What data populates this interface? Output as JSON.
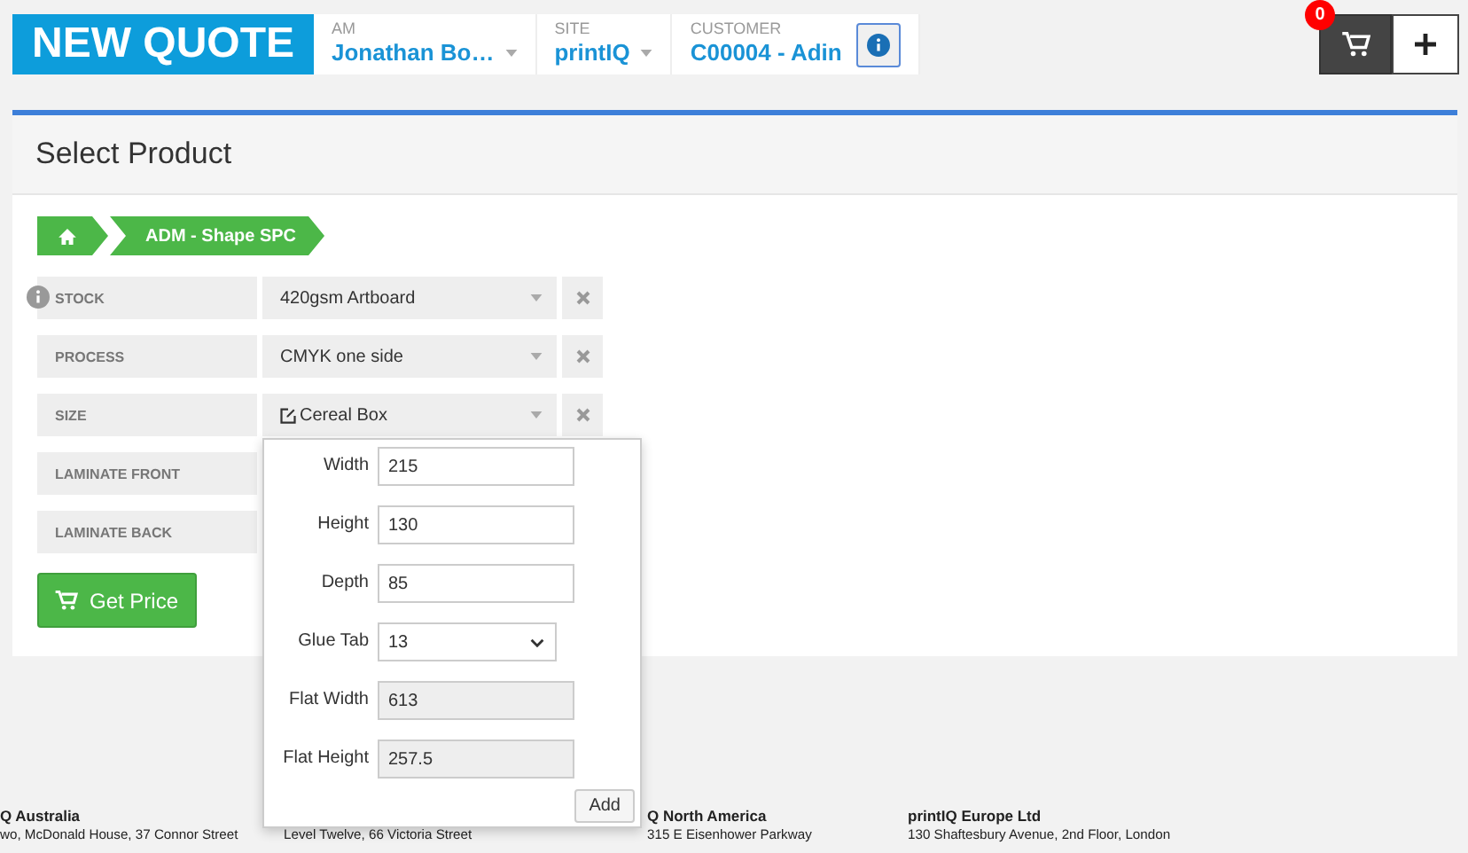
{
  "header": {
    "title": "NEW QUOTE",
    "fields": [
      {
        "label": "AM",
        "value": "Jonathan Bo…",
        "kind": "dropdown"
      },
      {
        "label": "SITE",
        "value": "printIQ",
        "kind": "dropdown"
      },
      {
        "label": "CUSTOMER",
        "value": "C00004 - Adin",
        "kind": "info"
      }
    ],
    "cart": {
      "count": "0"
    }
  },
  "panel": {
    "title": "Select Product",
    "breadcrumb": [
      {
        "kind": "home"
      },
      {
        "kind": "text",
        "label": "ADM - Shape SPC"
      }
    ],
    "options": [
      {
        "label": "STOCK",
        "value": "420gsm Artboard",
        "info": true,
        "editable": false,
        "removable": true
      },
      {
        "label": "PROCESS",
        "value": "CMYK one side",
        "info": false,
        "editable": false,
        "removable": true
      },
      {
        "label": "SIZE",
        "value": "Cereal Box",
        "info": false,
        "editable": true,
        "removable": true
      },
      {
        "label": "LAMINATE FRONT",
        "info": false,
        "removable": false
      },
      {
        "label": "LAMINATE BACK",
        "info": false,
        "removable": false
      }
    ],
    "get_price": "Get Price"
  },
  "size_popup": {
    "fields": [
      {
        "label": "Width",
        "value": "215",
        "kind": "input"
      },
      {
        "label": "Height",
        "value": "130",
        "kind": "input"
      },
      {
        "label": "Depth",
        "value": "85",
        "kind": "input"
      },
      {
        "label": "Glue Tab",
        "value": "13",
        "kind": "select"
      },
      {
        "label": "Flat Width",
        "value": "613",
        "kind": "readonly"
      },
      {
        "label": "Flat Height",
        "value": "257.5",
        "kind": "readonly"
      }
    ],
    "add": "Add"
  },
  "footer": [
    {
      "heading": "Q Australia",
      "lines": [
        "wo, McDonald House, 37 Connor Street"
      ]
    },
    {
      "lines": [
        "Level Twelve, 66 Victoria Street"
      ]
    },
    {
      "heading": "Q North America",
      "lines": [
        "315 E Eisenhower Parkway"
      ]
    },
    {
      "heading": "printIQ Europe Ltd",
      "lines": [
        "130 Shaftesbury Avenue, 2nd Floor, London"
      ]
    }
  ]
}
